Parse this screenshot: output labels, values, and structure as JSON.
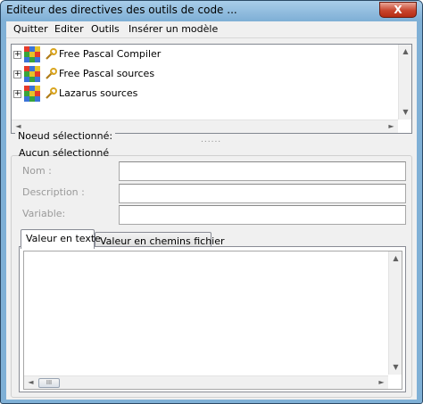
{
  "window": {
    "title": "Editeur des directives des outils de code ...",
    "close_glyph": "X"
  },
  "menu": {
    "items": [
      {
        "label": "Quitter"
      },
      {
        "label": "Editer"
      },
      {
        "label": "Outils"
      },
      {
        "label": "Insérer un modèle"
      }
    ]
  },
  "tree": {
    "items": [
      {
        "label": "Free Pascal Compiler",
        "expander": "+",
        "icon": "package-cube-icon"
      },
      {
        "label": "Free Pascal sources",
        "expander": "+",
        "icon": "package-cube-icon"
      },
      {
        "label": "Lazarus sources",
        "expander": "+",
        "icon": "package-cube-icon"
      }
    ],
    "scroll_up": "▲",
    "scroll_down": "▼",
    "scroll_left": "◄",
    "scroll_right": "►"
  },
  "splitter": {
    "grip": "......"
  },
  "node": {
    "group_caption": "Noeud sélectionné:",
    "selection_status": "Aucun sélectionné",
    "fields": [
      {
        "label": "Nom :",
        "value": ""
      },
      {
        "label": "Description :",
        "value": ""
      },
      {
        "label": "Variable:",
        "value": ""
      }
    ]
  },
  "tabs": [
    {
      "label": "Valeur en texte",
      "active": true
    },
    {
      "label": "Valeur en chemins fichier",
      "active": false
    }
  ],
  "memo": {
    "value": "",
    "scroll_up": "▲",
    "scroll_down": "▼",
    "scroll_left": "◄",
    "scroll_right": "►",
    "thumb_grip": "III"
  },
  "colors": {
    "titlebar": "#7fb0d6",
    "close_button": "#c8452d",
    "client_bg": "#f0f0f0"
  }
}
